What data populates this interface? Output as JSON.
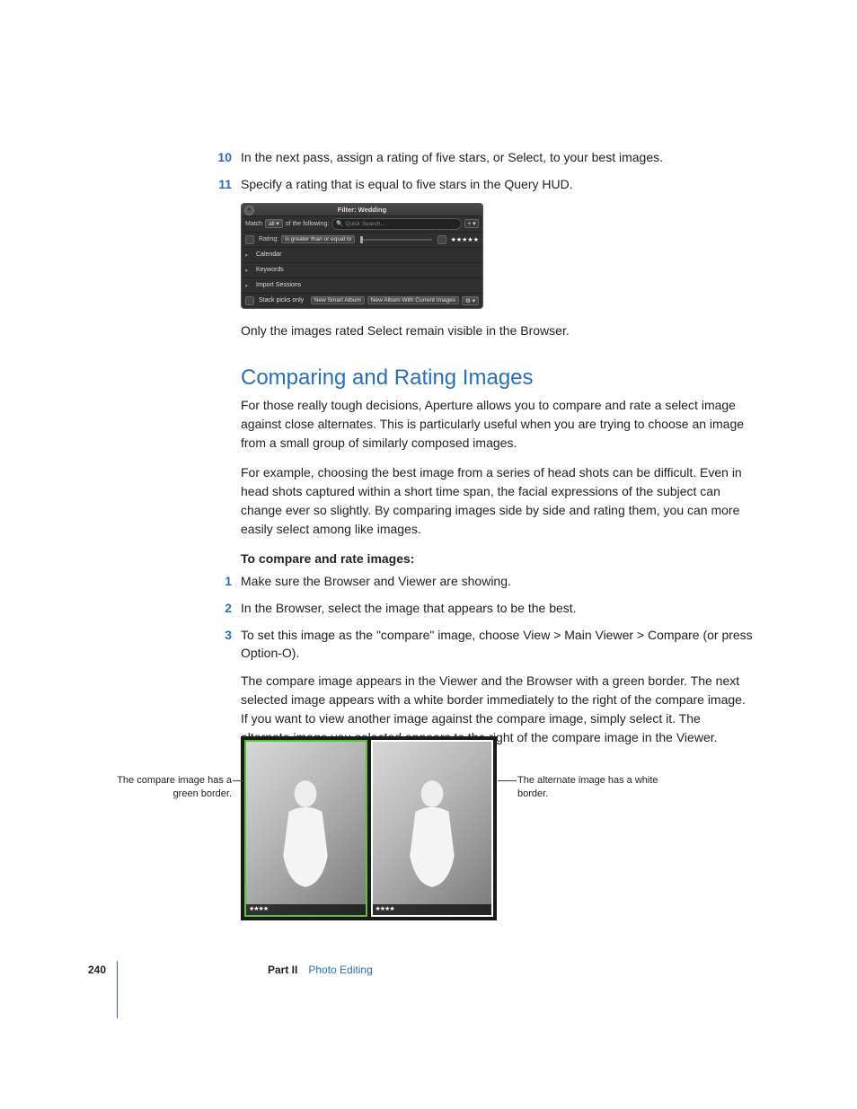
{
  "steps_top": [
    {
      "num": "10",
      "text": "In the next pass, assign a rating of five stars, or Select, to your best images."
    },
    {
      "num": "11",
      "text": "Specify a rating that is equal to five stars in the Query HUD."
    }
  ],
  "hud": {
    "title": "Filter: Wedding",
    "match": "Match",
    "all": "all",
    "of_following": "of the following:",
    "search_placeholder": "Quick Search...",
    "plus": "+",
    "dropdown": "▾",
    "rating_label": "Rating:",
    "rating_op": "is greater than or equal to",
    "stars": "★★★★★",
    "rows": [
      "Calendar",
      "Keywords",
      "Import Sessions"
    ],
    "stack_picks": "Stack picks only",
    "btn1": "New Smart Album",
    "btn2": "New Album With Current Images",
    "gear": "⚙",
    "gear_drop": "▾"
  },
  "after_hud": "Only the images rated Select remain visible in the Browser.",
  "heading": "Comparing and Rating Images",
  "para1": "For those really tough decisions, Aperture allows you to compare and rate a select image against close alternates. This is particularly useful when you are trying to choose an image from a small group of similarly composed images.",
  "para2": "For example, choosing the best image from a series of head shots can be difficult. Even in head shots captured within a short time span, the facial expressions of the subject can change ever so slightly. By comparing images side by side and rating them, you can more easily select among like images.",
  "subhead": "To compare and rate images:",
  "steps": [
    {
      "num": "1",
      "text": "Make sure the Browser and Viewer are showing."
    },
    {
      "num": "2",
      "text": "In the Browser, select the image that appears to be the best."
    },
    {
      "num": "3",
      "text": "To set this image as the \"compare\" image, choose View > Main Viewer > Compare (or press Option-O)."
    }
  ],
  "para3": "The compare image appears in the Viewer and the Browser with a green border. The next selected image appears with a white border immediately to the right of the compare image. If you want to view another image against the compare image, simply select it. The alternate image you selected appears to the right of the compare image in the Viewer.",
  "callout_left": "The compare image has a green border.",
  "callout_right": "The alternate image has a white border.",
  "photo_stars": "★★★★",
  "footer": {
    "page": "240",
    "part_label": "Part II",
    "section": "Photo Editing"
  }
}
